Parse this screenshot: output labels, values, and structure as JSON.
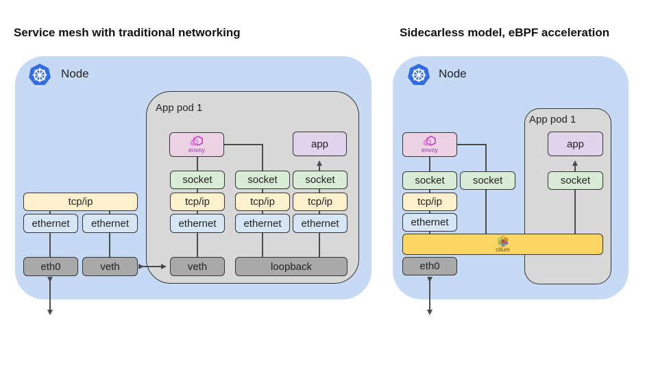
{
  "left": {
    "title": "Service mesh with traditional networking",
    "node_label": "Node",
    "node_icon": "kubernetes-helm-icon",
    "pod_label": "App pod 1",
    "host_stack": {
      "tcp": "tcp/ip",
      "ethernet_1": "ethernet",
      "ethernet_2": "ethernet",
      "eth0": "eth0",
      "veth": "veth"
    },
    "envoy": {
      "label": "envoy",
      "icon": "envoy-logo-icon"
    },
    "app": "app",
    "pod_columns": [
      {
        "socket": "socket",
        "tcp": "tcp/ip",
        "ethernet": "ethernet"
      },
      {
        "socket": "socket",
        "tcp": "tcp/ip",
        "ethernet": "ethernet"
      },
      {
        "socket": "socket",
        "tcp": "tcp/ip",
        "ethernet": "ethernet"
      }
    ],
    "pod_veth": "veth",
    "loopback": "loopback"
  },
  "right": {
    "title": "Sidecarless model, eBPF acceleration",
    "node_label": "Node",
    "node_icon": "kubernetes-helm-icon",
    "pod_label": "App pod 1",
    "envoy": {
      "label": "envoy",
      "icon": "envoy-logo-icon"
    },
    "socket_1": "socket",
    "socket_2": "socket",
    "tcp": "tcp/ip",
    "ethernet": "ethernet",
    "cilium": {
      "label": "cilium",
      "icon": "cilium-logo-icon"
    },
    "eth0": "eth0",
    "app": "app",
    "pod_socket": "socket"
  },
  "colors": {
    "node_bg": "#c6d9f5",
    "pod_bg": "#d8d8d8",
    "socket": "#d9ecd5",
    "tcp": "#fdf0cc",
    "ethernet": "#d6e6f5",
    "device": "#a9a9a9",
    "app": "#dfd4ec",
    "envoy": "#ecd3e3",
    "cilium": "#fcd663",
    "k8s_blue": "#326ce5"
  }
}
